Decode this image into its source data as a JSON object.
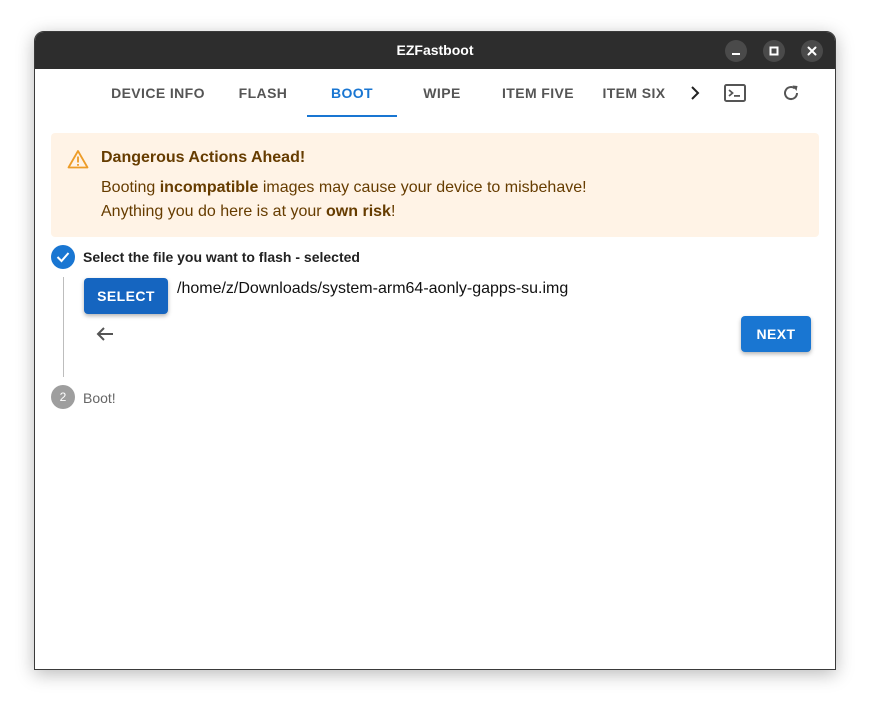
{
  "window": {
    "title": "EZFastboot"
  },
  "tabs": [
    {
      "label": "DEVICE INFO"
    },
    {
      "label": "FLASH"
    },
    {
      "label": "BOOT"
    },
    {
      "label": "WIPE"
    },
    {
      "label": "ITEM FIVE"
    },
    {
      "label": "ITEM SIX"
    }
  ],
  "icons": {
    "scroll_right": "chevron-right-icon",
    "terminal": "terminal-icon",
    "refresh": "refresh-icon",
    "warning": "warning-icon"
  },
  "alert": {
    "title": "Dangerous Actions Ahead!",
    "line1_pre": "Booting ",
    "line1_bold": "incompatible",
    "line1_post": " images may cause your device to misbehave!",
    "line2_pre": "Anything you do here is at your ",
    "line2_bold": "own risk",
    "line2_post": "!"
  },
  "stepper": {
    "step1": {
      "label": "Select the file you want to flash - selected"
    },
    "step2": {
      "number": "2",
      "label": "Boot!"
    },
    "select_button": "SELECT",
    "file_path": "/home/z/Downloads/system-arm64-aonly-gapps-su.img",
    "next_button": "NEXT"
  },
  "colors": {
    "accent": "#1976d2",
    "alert_bg": "#fff3e6",
    "alert_text": "#663c00",
    "warning_icon": "#ed9c28"
  }
}
